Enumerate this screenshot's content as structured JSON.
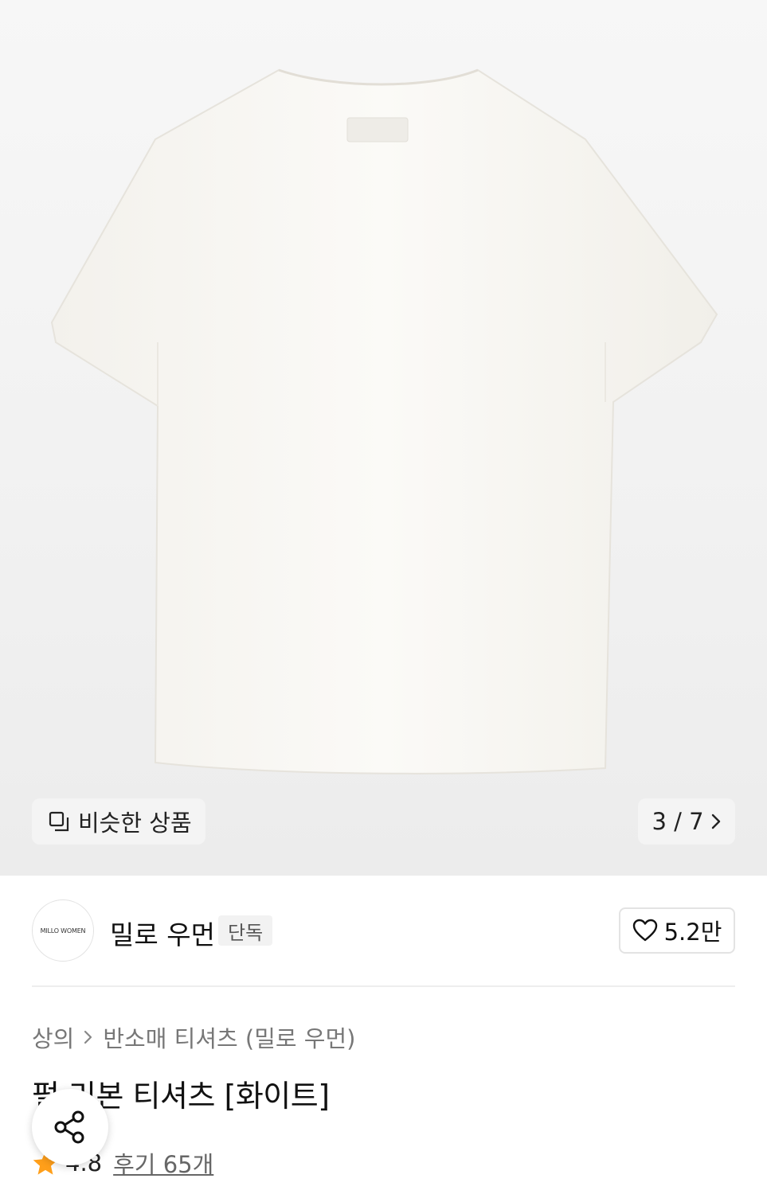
{
  "hero": {
    "similar_label": "비슷한 상품",
    "counter": "3 / 7"
  },
  "brand": {
    "logo_text": "MILLO WOMEN",
    "name": "밀로 우먼",
    "badge": "단독",
    "likes": "5.2만"
  },
  "breadcrumb": {
    "category": "상의",
    "subcategory": "반소매 티셔츠 (밀로 우먼)"
  },
  "product": {
    "title": "펄 리본 티셔츠 [화이트]",
    "rating": "4.8",
    "reviews": "후기 65개"
  },
  "colors": {
    "star": "#ff9f1a",
    "accent": "#111111"
  },
  "icons": [
    "similar-items-icon",
    "chevron-right-icon",
    "heart-icon",
    "share-icon",
    "star-icon"
  ]
}
